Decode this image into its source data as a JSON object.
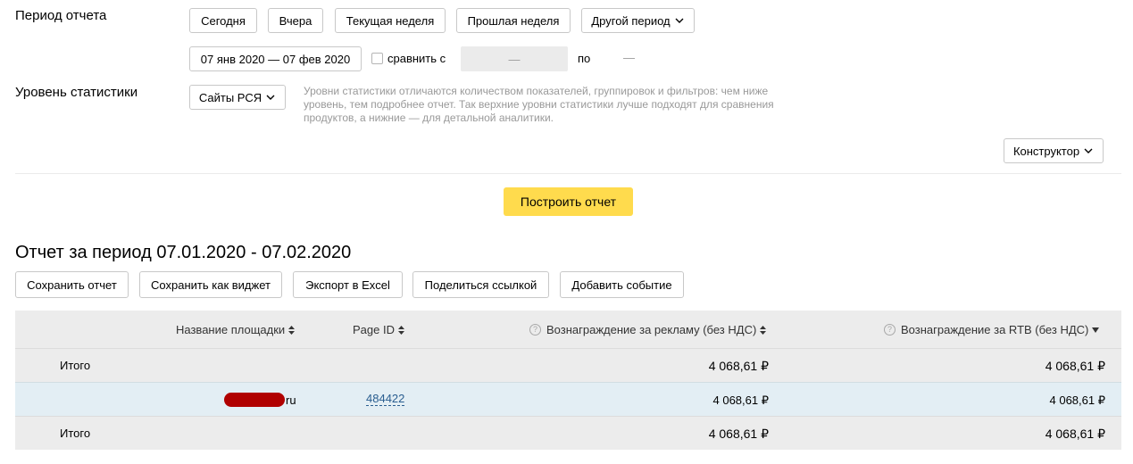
{
  "period": {
    "label": "Период отчета",
    "presets": [
      "Сегодня",
      "Вчера",
      "Текущая неделя",
      "Прошлая неделя"
    ],
    "other_period": "Другой период",
    "date_range": "07 янв 2020 — 07 фев 2020",
    "compare_label": "сравнить с",
    "compare_from": "—",
    "compare_to_label": "по",
    "compare_to": "—"
  },
  "stat_level": {
    "label": "Уровень статистики",
    "value": "Сайты РСЯ",
    "hint_line1": "Уровни статистики отличаются количеством показателей, группировок и фильтров: чем ниже",
    "hint_line2": "уровень, тем подробнее отчет. Так верхние уровни статистики лучше подходят для сравнения",
    "hint_line3": "продуктов, а нижние — для детальной аналитики."
  },
  "constructor_label": "Конструктор",
  "build_report": "Построить отчет",
  "report": {
    "title": "Отчет за период 07.01.2020 - 07.02.2020",
    "actions": [
      "Сохранить отчет",
      "Сохранить как виджет",
      "Экспорт в Excel",
      "Поделиться ссылкой",
      "Добавить событие"
    ]
  },
  "table": {
    "headers": {
      "site_name": "Название площадки",
      "page_id": "Page ID",
      "reward_ads": "Вознаграждение за рекламу (без НДС)",
      "reward_rtb": "Вознаграждение за RTB (без НДС)"
    },
    "total_label": "Итого",
    "rows": [
      {
        "type": "total",
        "label": "Итого",
        "reward_ads": "4 068,61 ₽",
        "reward_rtb": "4 068,61 ₽"
      },
      {
        "type": "site",
        "site_suffix": "ru",
        "page_id": "484422",
        "reward_ads": "4 068,61 ₽",
        "reward_rtb": "4 068,61 ₽"
      },
      {
        "type": "total",
        "label": "Итого",
        "reward_ads": "4 068,61 ₽",
        "reward_rtb": "4 068,61 ₽"
      }
    ]
  },
  "colors": {
    "accent_button": "#ffdb4d",
    "link": "#2a5e90",
    "selected_row": "#e3eef4",
    "redaction": "#b00000"
  },
  "icons": [
    "chevron-down-icon",
    "sort-up-down-icon",
    "sort-down-icon",
    "question-icon",
    "checkbox"
  ]
}
